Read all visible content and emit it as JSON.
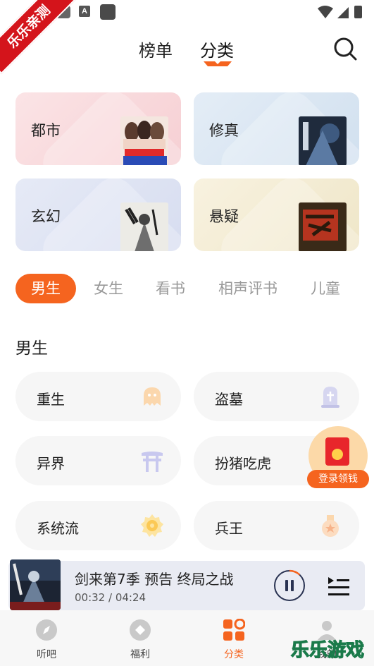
{
  "corner_ribbon": "乐乐亲测",
  "header": {
    "tabs": [
      {
        "label": "榜单"
      },
      {
        "label": "分类",
        "active": true
      }
    ]
  },
  "categories": [
    {
      "label": "都市"
    },
    {
      "label": "修真"
    },
    {
      "label": "玄幻"
    },
    {
      "label": "悬疑"
    }
  ],
  "gender_tabs": [
    {
      "label": "男生",
      "active": true
    },
    {
      "label": "女生"
    },
    {
      "label": "看书"
    },
    {
      "label": "相声评书"
    },
    {
      "label": "儿童"
    }
  ],
  "section": {
    "title": "男生",
    "items": [
      {
        "label": "重生",
        "icon": "ghost-icon"
      },
      {
        "label": "盗墓",
        "icon": "tombstone-icon"
      },
      {
        "label": "异界",
        "icon": "torii-gate-icon"
      },
      {
        "label": "扮猪吃虎",
        "icon": "pig-icon"
      },
      {
        "label": "系统流",
        "icon": "gear-badge-icon"
      },
      {
        "label": "兵王",
        "icon": "medal-icon"
      }
    ]
  },
  "reward": {
    "label": "登录领钱"
  },
  "player": {
    "title": "剑来第7季 预告 终局之战",
    "time": "00:32 / 04:24",
    "progress": 0.12
  },
  "bottom_nav": [
    {
      "label": "听吧"
    },
    {
      "label": "福利"
    },
    {
      "label": "分类",
      "active": true
    },
    {
      "label": "我的"
    }
  ],
  "watermark": "乐乐游戏",
  "colors": {
    "accent": "#f5641f",
    "player_bg": "#e9ebf3",
    "pill_bg": "#f6f6f6"
  }
}
